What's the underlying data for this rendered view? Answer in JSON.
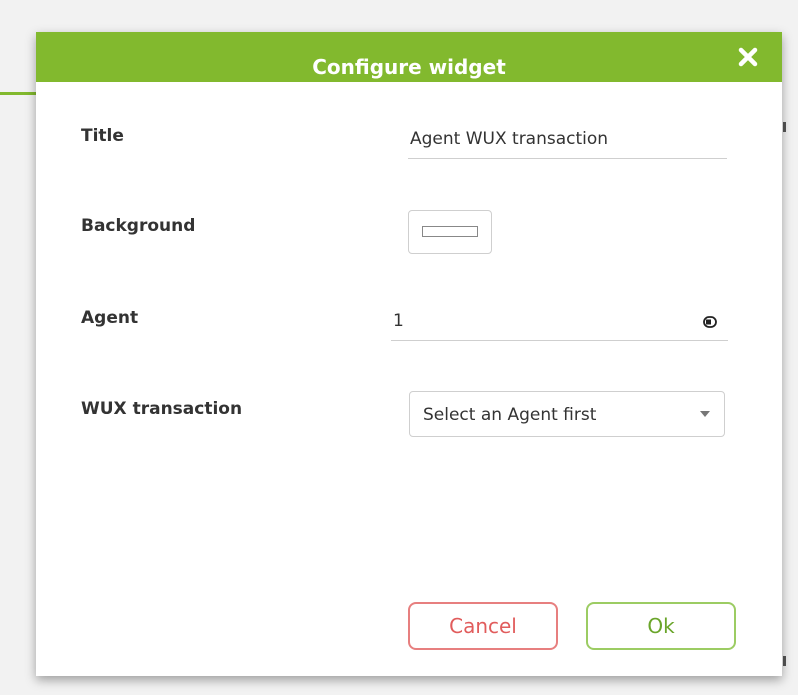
{
  "dialog": {
    "title": "Configure widget",
    "close_icon": "close-icon",
    "header_color": "#82b92e"
  },
  "fields": {
    "title_label": "Title",
    "title_value": "Agent WUX transaction",
    "background_label": "Background",
    "background_color": "#ffffff",
    "agent_label": "Agent",
    "agent_value": "1",
    "agent_icon": "agent-picker-icon",
    "wux_label": "WUX transaction",
    "wux_selected": "Select an Agent first"
  },
  "buttons": {
    "cancel_label": "Cancel",
    "cancel_color": "#e15c5c",
    "ok_label": "Ok",
    "ok_color": "#6aa52a"
  }
}
